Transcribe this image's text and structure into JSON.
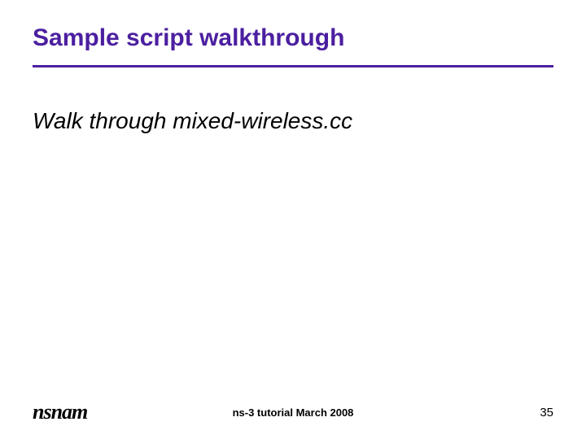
{
  "slide": {
    "title": "Sample script walkthrough",
    "body": "Walk through mixed-wireless.cc"
  },
  "footer": {
    "logo": "nsnam",
    "center": "ns-3 tutorial March 2008",
    "page": "35"
  }
}
